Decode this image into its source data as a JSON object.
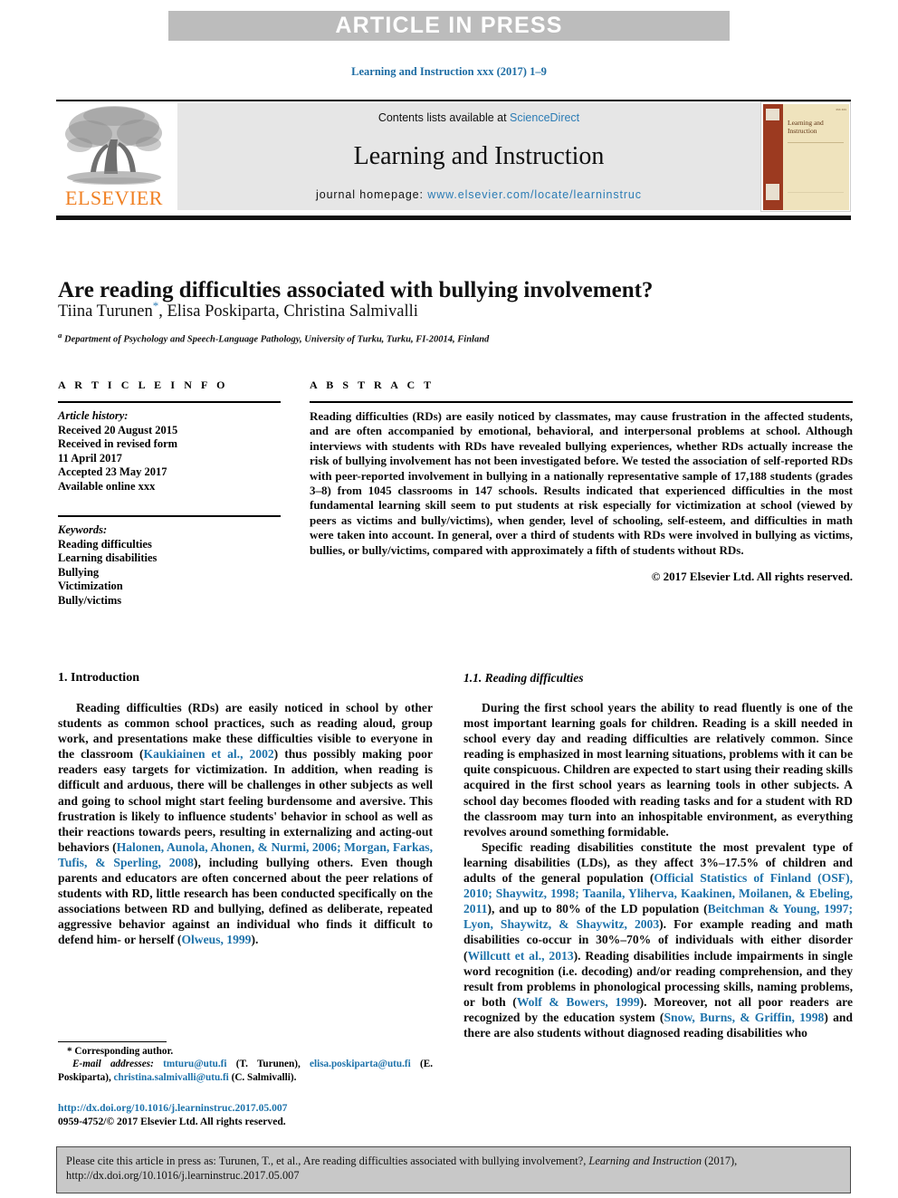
{
  "banner": {
    "text": "ARTICLE IN PRESS"
  },
  "running_head": "Learning and Instruction xxx (2017) 1–9",
  "header": {
    "publisher": "ELSEVIER",
    "contents_prefix": "Contents lists available at ",
    "contents_link": "ScienceDirect",
    "journal_title": "Learning and Instruction",
    "homepage_prefix": "journal homepage: ",
    "homepage_url": "www.elsevier.com/locate/learninstruc",
    "cover_title": "Learning and Instruction",
    "cover_issue": "xxx xxx"
  },
  "article": {
    "title": "Are reading difficulties associated with bullying involvement?",
    "authors": "Tiina Turunen, Elisa Poskiparta, Christina Salmivalli",
    "author_1": "Tiina Turunen",
    "author_rest": ", Elisa Poskiparta, Christina Salmivalli",
    "corresponding_marker": "*",
    "affiliation_marker": "a",
    "affiliation": "Department of Psychology and Speech-Language Pathology, University of Turku, Turku, FI-20014, Finland"
  },
  "info": {
    "heading": "A R T I C L E   I N F O",
    "history_label": "Article history:",
    "history": [
      "Received 20 August 2015",
      "Received in revised form",
      "11 April 2017",
      "Accepted 23 May 2017",
      "Available online xxx"
    ],
    "keywords_label": "Keywords:",
    "keywords": [
      "Reading difficulties",
      "Learning disabilities",
      "Bullying",
      "Victimization",
      "Bully/victims"
    ]
  },
  "abstract": {
    "heading": "A B S T R A C T",
    "body": "Reading difficulties (RDs) are easily noticed by classmates, may cause frustration in the affected students, and are often accompanied by emotional, behavioral, and interpersonal problems at school. Although interviews with students with RDs have revealed bullying experiences, whether RDs actually increase the risk of bullying involvement has not been investigated before. We tested the association of self-reported RDs with peer-reported involvement in bullying in a nationally representative sample of 17,188 students (grades 3–8) from 1045 classrooms in 147 schools. Results indicated that experienced difficulties in the most fundamental learning skill seem to put students at risk especially for victimization at school (viewed by peers as victims and bully/victims), when gender, level of schooling, self-esteem, and difficulties in math were taken into account. In general, over a third of students with RDs were involved in bullying as victims, bullies, or bully/victims, compared with approximately a fifth of students without RDs.",
    "copyright": "© 2017 Elsevier Ltd. All rights reserved."
  },
  "sections": {
    "intro_heading": "1. Introduction",
    "intro_par_1a": "Reading difficulties (RDs) are easily noticed in school by other students as common school practices, such as reading aloud, group work, and presentations make these difficulties visible to everyone in the classroom (",
    "intro_cite_1": "Kaukiainen et al., 2002",
    "intro_par_1b": ") thus possibly making poor readers easy targets for victimization. In addition, when reading is difficult and arduous, there will be challenges in other subjects as well and going to school might start feeling burdensome and aversive. This frustration is likely to influence students' behavior in school as well as their reactions towards peers, resulting in externalizing and acting-out behaviors (",
    "intro_cite_2": "Halonen, Aunola, Ahonen, & Nurmi, 2006; Morgan, Farkas, Tufis, & Sperling, 2008",
    "intro_par_1c": "), including bullying others. Even though parents and educators are often concerned about the peer relations of students with RD, little research has been conducted specifically on the associations between RD and bullying, defined as deliberate, repeated aggressive behavior against an individual who finds it difficult to defend him- or herself (",
    "intro_cite_3": "Olweus, 1999",
    "intro_par_1d": ").",
    "rd_heading": "1.1. Reading difficulties",
    "rd_par_1": "During the first school years the ability to read fluently is one of the most important learning goals for children. Reading is a skill needed in school every day and reading difficulties are relatively common. Since reading is emphasized in most learning situations, problems with it can be quite conspicuous. Children are expected to start using their reading skills acquired in the first school years as learning tools in other subjects. A school day becomes flooded with reading tasks and for a student with RD the classroom may turn into an inhospitable environment, as everything revolves around something formidable.",
    "rd_par_2a": "Specific reading disabilities constitute the most prevalent type of learning disabilities (LDs), as they affect 3%–17.5% of children and adults of the general population (",
    "rd_cite_1": "Official Statistics of Finland (OSF), 2010; Shaywitz, 1998; Taanila, Yliherva, Kaakinen, Moilanen, & Ebeling, 2011",
    "rd_par_2b": "), and up to 80% of the LD population (",
    "rd_cite_2": "Beitchman & Young, 1997; Lyon, Shaywitz, & Shaywitz, 2003",
    "rd_par_2c": "). For example reading and math disabilities co-occur in 30%–70% of individuals with either disorder (",
    "rd_cite_3": "Willcutt et al., 2013",
    "rd_par_2d": "). Reading disabilities include impairments in single word recognition (i.e. decoding) and/or reading comprehension, and they result from problems in phonological processing skills, naming problems, or both (",
    "rd_cite_4": "Wolf & Bowers, 1999",
    "rd_par_2e": "). Moreover, not all poor readers are recognized by the education system (",
    "rd_cite_5": "Snow, Burns, & Griffin, 1998",
    "rd_par_2f": ") and there are also students without diagnosed reading disabilities who"
  },
  "footnote": {
    "corresponding": "* Corresponding author.",
    "emails_label": "E-mail addresses:",
    "email_1": "tmturu@utu.fi",
    "email_1_owner": "(T. Turunen),",
    "email_2": "elisa.poskiparta@utu.fi",
    "email_2_owner": "(E. Poskiparta),",
    "email_3": "christina.salmivalli@utu.fi",
    "email_3_owner": "(C. Salmivalli).",
    "doi": "http://dx.doi.org/10.1016/j.learninstruc.2017.05.007",
    "issn_line": "0959-4752/© 2017 Elsevier Ltd. All rights reserved."
  },
  "cite_box": {
    "prefix": "Please cite this article in press as: Turunen, T., et al., Are reading difficulties associated with bullying involvement?, ",
    "journal": "Learning and Instruction",
    "suffix": " (2017), http://dx.doi.org/10.1016/j.learninstruc.2017.05.007"
  },
  "colors": {
    "banner_bg": "#bcbcbc",
    "link_blue": "#1d72aa",
    "elsevier_orange": "#f08023",
    "contents_bg": "#e6e6e6",
    "cite_box_bg": "#c8c8c8"
  }
}
